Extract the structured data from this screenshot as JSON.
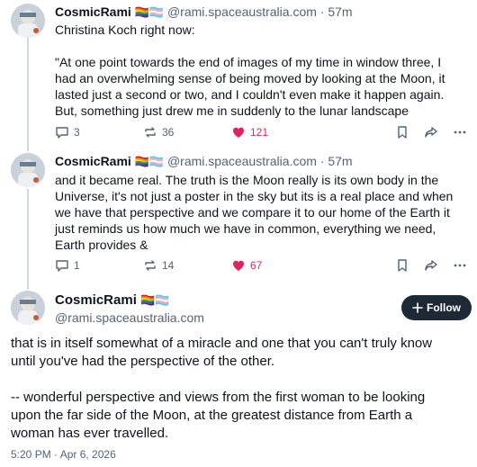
{
  "posts": [
    {
      "name": "CosmicRami",
      "flags": "🏳️‍🌈🏳️‍⚧️",
      "handle": "@rami.spaceaustralia.com",
      "time": "57m",
      "lines": [
        "Christina Koch right now:",
        "",
        "\"At one point towards the end of images of my time in window three, I",
        "had an overwhelming sense of being moved by looking at the Moon, it",
        "lasted just a second or two, and I couldn't even make it happen again.",
        "But, something just drew me in suddenly to the lunar landscape"
      ],
      "replies": "3",
      "reposts": "36",
      "likes": "121"
    },
    {
      "name": "CosmicRami",
      "flags": "🏳️‍🌈🏳️‍⚧️",
      "handle": "@rami.spaceaustralia.com",
      "time": "57m",
      "lines": [
        "and it became real. The truth is the Moon really is its own body in the",
        "Universe, it's not just a poster in the sky but its is a real place and when",
        "we have that perspective and we compare it to our home of the Earth it",
        "just reminds us how much we have in common, everything we need,",
        "Earth provides &"
      ],
      "replies": "1",
      "reposts": "14",
      "likes": "67"
    }
  ],
  "main": {
    "name": "CosmicRami",
    "flags": "🏳️‍🌈🏳️‍⚧️",
    "handle": "@rami.spaceaustralia.com",
    "follow_label": "Follow",
    "paragraphs": [
      [
        "that is in itself somewhat of a miracle and one that you can't truly know",
        "until you've had the perspective of the other."
      ],
      [
        "-- wonderful perspective and views from the first woman to be looking",
        "upon the far side of the Moon, at the greatest distance from Earth a",
        "woman has ever travelled."
      ]
    ],
    "timestamp": "5:20 PM · Apr 6, 2026"
  },
  "icons": {
    "reply": "reply-icon",
    "repost": "repost-icon",
    "like": "heart-icon",
    "bookmark": "bookmark-icon",
    "share": "share-icon",
    "more": "more-icon"
  },
  "colors": {
    "like": "#e0245e",
    "muted": "#536471",
    "follow_bg": "#1d2a35"
  }
}
